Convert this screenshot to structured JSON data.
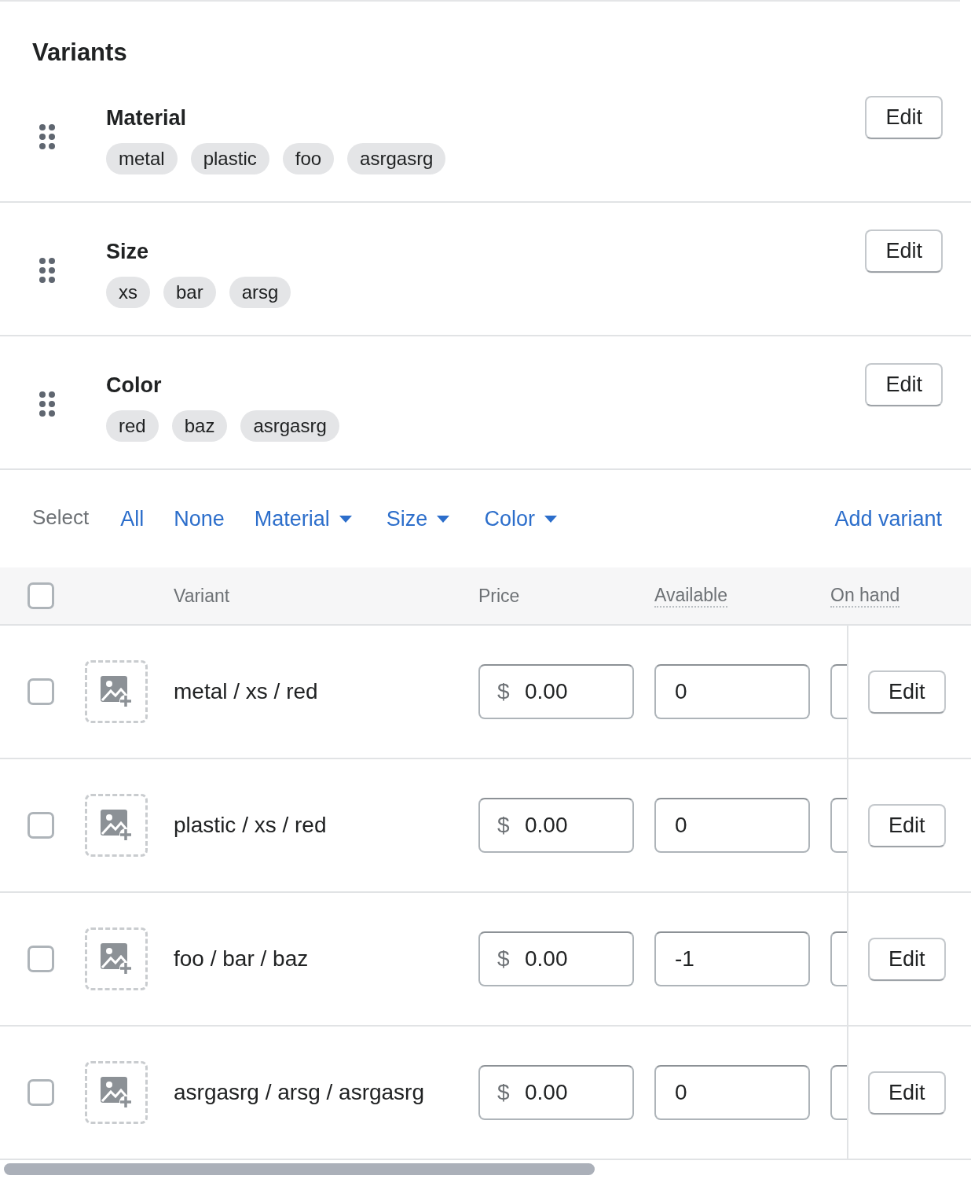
{
  "section": {
    "title": "Variants"
  },
  "options": [
    {
      "name": "Material",
      "values": [
        "metal",
        "plastic",
        "foo",
        "asrgasrg"
      ],
      "edit": "Edit"
    },
    {
      "name": "Size",
      "values": [
        "xs",
        "bar",
        "arsg"
      ],
      "edit": "Edit"
    },
    {
      "name": "Color",
      "values": [
        "red",
        "baz",
        "asrgasrg"
      ],
      "edit": "Edit"
    }
  ],
  "select_bar": {
    "label": "Select",
    "filters": [
      {
        "label": "All",
        "kind": "link"
      },
      {
        "label": "None",
        "kind": "link"
      },
      {
        "label": "Material",
        "kind": "dropdown"
      },
      {
        "label": "Size",
        "kind": "dropdown"
      },
      {
        "label": "Color",
        "kind": "dropdown"
      }
    ],
    "action": "Add variant"
  },
  "table": {
    "select_all": {
      "checked": false
    },
    "columns": [
      {
        "label": "Variant",
        "tooltip": false
      },
      {
        "label": "Price",
        "tooltip": false
      },
      {
        "label": "Available",
        "tooltip": true
      },
      {
        "label": "On hand",
        "tooltip": true
      }
    ],
    "rows": [
      {
        "checked": false,
        "variant": "metal / xs / red",
        "currency": "$",
        "price": "0.00",
        "available": "0",
        "edit": "Edit"
      },
      {
        "checked": false,
        "variant": "plastic / xs / red",
        "currency": "$",
        "price": "0.00",
        "available": "0",
        "edit": "Edit"
      },
      {
        "checked": false,
        "variant": "foo / bar / baz",
        "currency": "$",
        "price": "0.00",
        "available": "-1",
        "edit": "Edit"
      },
      {
        "checked": false,
        "variant": "asrgasrg / arsg / asrgasrg",
        "currency": "$",
        "price": "0.00",
        "available": "0",
        "edit": "Edit"
      }
    ]
  }
}
